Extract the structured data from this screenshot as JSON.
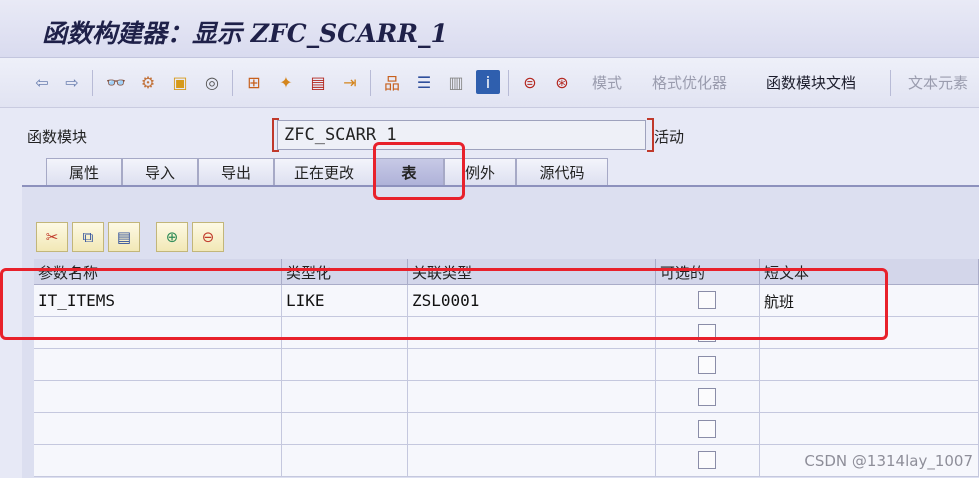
{
  "window": {
    "title": "函数构建器：显示 ZFC_SCARR_1"
  },
  "toolbar": {
    "icons": [
      "back-icon",
      "forward-icon",
      "glasses-icon",
      "gear-people-icon",
      "object-copy-icon",
      "spiral-icon",
      "hierarchy-icon",
      "magic-wand-icon",
      "display-object-icon",
      "move-object-icon",
      "tree-icon",
      "stack-icon",
      "list-icon",
      "info-icon",
      "pattern-icon",
      "pretty-print-icon"
    ],
    "pattern_label": "模式",
    "pretty_printer_label": "格式优化器",
    "fm_doc_label": "函数模块文档",
    "text_elements_label": "文本元素"
  },
  "form": {
    "function_module_label": "函数模块",
    "function_module_value": "ZFC_SCARR_1",
    "status": "活动"
  },
  "tabs": [
    {
      "label": "属性"
    },
    {
      "label": "导入"
    },
    {
      "label": "导出"
    },
    {
      "label": "正在更改"
    },
    {
      "label": "表"
    },
    {
      "label": "例外"
    },
    {
      "label": "源代码"
    }
  ],
  "active_tab": "表",
  "table": {
    "columns": [
      "参数名称",
      "类型化",
      "关联类型",
      "可选的",
      "短文本"
    ],
    "rows": [
      {
        "param": "IT_ITEMS",
        "typing": "LIKE",
        "assoc_type": "ZSL0001",
        "optional": false,
        "short_text": "航班"
      },
      {
        "param": "",
        "typing": "",
        "assoc_type": "",
        "optional": false,
        "short_text": ""
      },
      {
        "param": "",
        "typing": "",
        "assoc_type": "",
        "optional": false,
        "short_text": ""
      },
      {
        "param": "",
        "typing": "",
        "assoc_type": "",
        "optional": false,
        "short_text": ""
      },
      {
        "param": "",
        "typing": "",
        "assoc_type": "",
        "optional": false,
        "short_text": ""
      },
      {
        "param": "",
        "typing": "",
        "assoc_type": "",
        "optional": false,
        "short_text": ""
      }
    ]
  },
  "watermark": "CSDN @1314lay_1007",
  "colors": {
    "highlight": "#e8212b",
    "active_tab": "#aeb1d8",
    "title": "#1f2149"
  }
}
